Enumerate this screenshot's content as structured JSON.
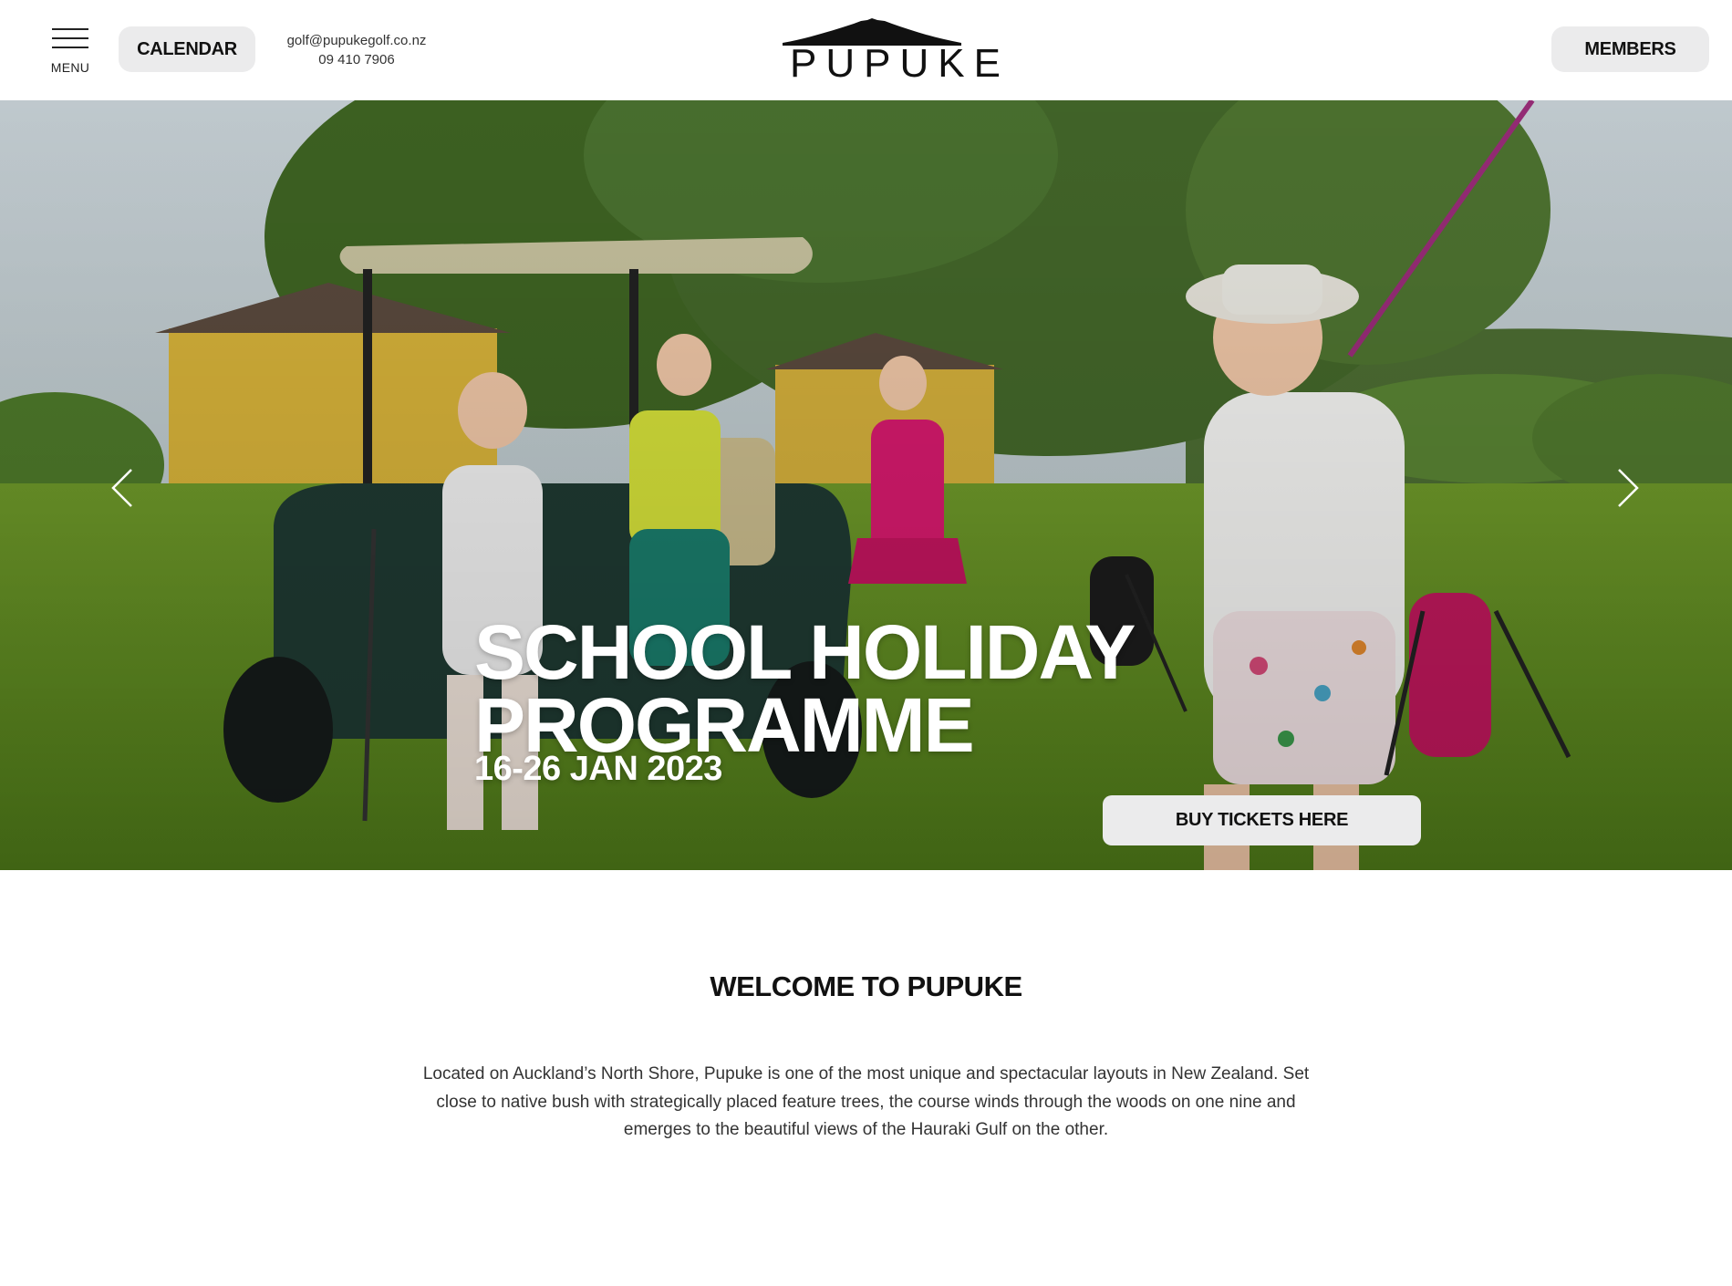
{
  "header": {
    "menu_label": "MENU",
    "calendar_label": "CALENDAR",
    "email": "golf@pupukegolf.co.nz",
    "phone": "09 410 7906",
    "logo_text": "PUPUKE",
    "members_label": "MEMBERS"
  },
  "hero": {
    "title": "SCHOOL HOLIDAY\nPROGRAMME",
    "date": "16-26 JAN 2023",
    "cta_label": "BUY TICKETS HERE",
    "prev_icon": "chevron-left-icon",
    "next_icon": "chevron-right-icon"
  },
  "welcome": {
    "title": "WELCOME TO PUPUKE",
    "body": "Located on Auckland’s North Shore, Pupuke is one of the most unique and spectacular layouts in New Zealand. Set close to native bush with strategically placed feature trees, the course winds through the woods on one nine and emerges to the beautiful views of the Hauraki Gulf on the other."
  },
  "colors": {
    "button_bg": "#ebebec",
    "text": "#111111",
    "hero_text": "#ffffff"
  }
}
